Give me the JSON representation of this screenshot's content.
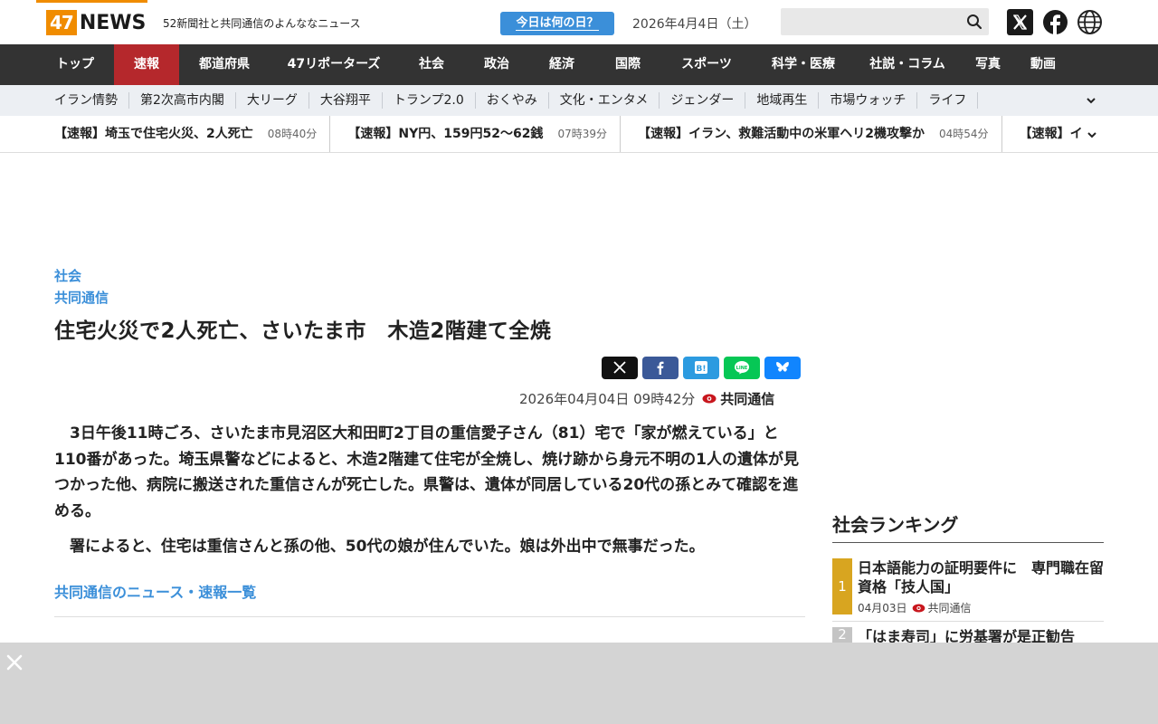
{
  "header": {
    "logo_num": "47",
    "logo_text": "NEWS",
    "tagline": "52新聞社と共同通信のよんななニュース",
    "today_button": "今日は何の日？",
    "date": "2026年4月4日（土）",
    "search_placeholder": ""
  },
  "main_nav": [
    {
      "label": "トップ"
    },
    {
      "label": "速報"
    },
    {
      "label": "都道府県"
    },
    {
      "label": "47リポーターズ"
    },
    {
      "label": "社会"
    },
    {
      "label": "政治"
    },
    {
      "label": "経済"
    },
    {
      "label": "国際"
    },
    {
      "label": "スポーツ"
    },
    {
      "label": "科学・医療"
    },
    {
      "label": "社説・コラム"
    },
    {
      "label": "写真"
    },
    {
      "label": "動画"
    }
  ],
  "sub_nav": [
    {
      "label": "イラン情勢"
    },
    {
      "label": "第2次高市内閣"
    },
    {
      "label": "大リーグ"
    },
    {
      "label": "大谷翔平"
    },
    {
      "label": "トランプ2.0"
    },
    {
      "label": "おくやみ"
    },
    {
      "label": "文化・エンタメ"
    },
    {
      "label": "ジェンダー"
    },
    {
      "label": "地域再生"
    },
    {
      "label": "市場ウォッチ"
    },
    {
      "label": "ライフ"
    }
  ],
  "ticker": [
    {
      "title": "【速報】埼玉で住宅火災、2人死亡",
      "time": "08時40分"
    },
    {
      "title": "【速報】NY円、159円52～62銭",
      "time": "07時39分"
    },
    {
      "title": "【速報】イラン、救難活動中の米軍ヘリ2機攻撃か",
      "time": "04時54分"
    },
    {
      "title": "【速報】イランと",
      "time": ""
    }
  ],
  "article": {
    "category": "社会",
    "source": "共同通信",
    "title": "住宅火災で2人死亡、さいたま市　木造2階建て全焼",
    "published": "2026年04月04日 09時42分",
    "agency": "共同通信",
    "paragraphs": [
      "3日午後11時ごろ、さいたま市見沼区大和田町2丁目の重信愛子さん（81）宅で「家が燃えている」と110番があった。埼玉県警などによると、木造2階建て住宅が全焼し、焼け跡から身元不明の1人の遺体が見つかった他、病院に搬送された重信さんが死亡した。県警は、遺体が同居している20代の孫とみて確認を進める。",
      "署によると、住宅は重信さんと孫の他、50代の娘が住んでいた。娘は外出中で無事だった。"
    ],
    "more_link": "共同通信のニュース・速報一覧"
  },
  "ranking": {
    "heading": "社会ランキング",
    "items": [
      {
        "rank": "1",
        "title": "日本語能力の証明要件に　専門職在留資格「技人国」",
        "date": "04月03日",
        "agency": "共同通信"
      },
      {
        "rank": "2",
        "title": "「はま寿司」に労基署が是正勧告",
        "date": "",
        "agency": ""
      }
    ]
  },
  "colors": {
    "brand_orange": "#f08c00",
    "nav_dark": "#333333",
    "nav_active": "#b5282c",
    "link_blue": "#3b8fd9",
    "rank_gold": "#d8a520"
  }
}
